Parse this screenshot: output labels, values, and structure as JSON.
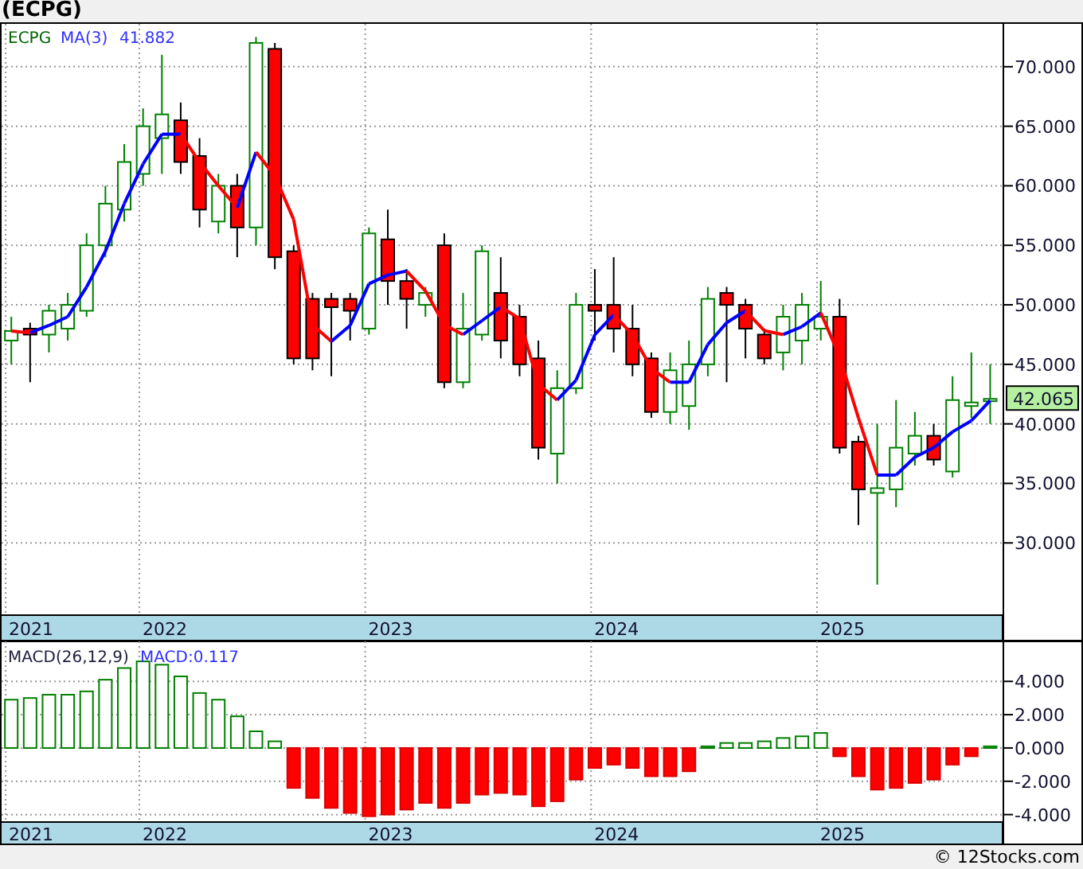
{
  "title": "(ECPG)",
  "price_chart": {
    "legend": {
      "indicator": "MA(3)",
      "indicator_value": "41.882"
    },
    "last_price": "42.065",
    "year_labels": [
      "2021",
      "2022",
      "2023",
      "2024",
      "2025"
    ],
    "chart_data": {
      "type": "candlestick",
      "title": "ECPG",
      "grid": true,
      "ylim": [
        24,
        73.6
      ],
      "ohlc": [
        [
          47,
          49,
          45,
          47.8
        ],
        [
          48,
          48.5,
          43.5,
          47.5
        ],
        [
          47.5,
          50,
          46,
          49.5
        ],
        [
          48,
          51,
          47,
          50
        ],
        [
          49.5,
          56,
          49,
          55
        ],
        [
          55,
          60,
          54,
          58.5
        ],
        [
          58,
          63.5,
          57,
          62
        ],
        [
          61,
          66.5,
          60,
          65
        ],
        [
          64,
          71,
          61,
          66
        ],
        [
          65.5,
          67,
          61,
          62
        ],
        [
          62.5,
          64,
          56.5,
          58
        ],
        [
          57,
          61,
          56,
          60
        ],
        [
          60,
          61,
          54,
          56.5
        ],
        [
          56.5,
          72.5,
          55,
          72
        ],
        [
          71.5,
          72,
          53,
          54
        ],
        [
          54.5,
          55,
          45,
          45.5
        ],
        [
          50.5,
          51,
          44.5,
          45.5
        ],
        [
          50.5,
          51,
          44,
          49.8
        ],
        [
          50.5,
          51,
          47,
          49.5
        ],
        [
          48,
          56.5,
          47.5,
          56
        ],
        [
          55.5,
          58,
          50,
          52
        ],
        [
          52,
          53,
          48,
          50.5
        ],
        [
          50,
          51.5,
          49,
          51
        ],
        [
          55,
          56,
          43,
          43.5
        ],
        [
          43.5,
          51,
          43,
          48
        ],
        [
          47.5,
          55,
          47,
          54.5
        ],
        [
          51,
          54,
          45.5,
          47
        ],
        [
          49,
          50,
          44,
          45
        ],
        [
          45.5,
          47,
          37,
          38
        ],
        [
          37.5,
          44.5,
          35,
          43
        ],
        [
          43,
          51,
          42.5,
          50
        ],
        [
          50,
          53,
          47,
          49.5
        ],
        [
          50,
          54,
          46,
          48
        ],
        [
          48,
          50,
          44,
          45
        ],
        [
          45.5,
          46,
          40.5,
          41
        ],
        [
          41,
          46,
          40,
          44.5
        ],
        [
          41.5,
          47,
          39.5,
          45
        ],
        [
          45,
          51.5,
          44,
          50.5
        ],
        [
          51,
          51.5,
          43.5,
          50
        ],
        [
          50,
          50.5,
          45.5,
          48
        ],
        [
          47.5,
          48,
          45,
          45.5
        ],
        [
          46,
          50,
          44.5,
          49
        ],
        [
          47,
          51,
          45,
          50
        ],
        [
          48,
          52,
          47,
          49
        ],
        [
          49,
          50.5,
          37.5,
          38
        ],
        [
          38.5,
          39,
          31.5,
          34.5
        ],
        [
          34.2,
          40,
          26.5,
          34.6
        ],
        [
          34.5,
          42,
          33,
          38
        ],
        [
          37.5,
          41,
          36.5,
          39
        ],
        [
          39,
          40,
          36.5,
          37
        ],
        [
          36,
          44,
          35.5,
          42
        ],
        [
          41.5,
          46,
          40.5,
          41.8
        ],
        [
          41.9,
          45,
          40,
          42.1
        ]
      ],
      "yticks": [
        {
          "value": 30,
          "label": "30.000"
        },
        {
          "value": 35,
          "label": "35.000"
        },
        {
          "value": 40,
          "label": "40.000"
        },
        {
          "value": 45,
          "label": "45.000"
        },
        {
          "value": 50,
          "label": "50.000"
        },
        {
          "value": 55,
          "label": "55.000"
        },
        {
          "value": 60,
          "label": "60.000"
        },
        {
          "value": 65,
          "label": "65.000"
        },
        {
          "value": 70,
          "label": "70.000"
        }
      ]
    }
  },
  "macd_chart": {
    "legend": {
      "name": "MACD(26,12,9)",
      "value": "MACD:0.117"
    },
    "year_labels": [
      "2021",
      "2022",
      "2023",
      "2024",
      "2025"
    ],
    "chart_data": {
      "type": "bar",
      "grid": true,
      "ylim": [
        -4.4,
        6.4
      ],
      "values": [
        2.9,
        3.0,
        3.2,
        3.2,
        3.4,
        4.1,
        4.8,
        5.2,
        5.0,
        4.3,
        3.3,
        2.9,
        1.9,
        1.0,
        0.4,
        -2.4,
        -3.0,
        -3.6,
        -3.9,
        -4.1,
        -4.0,
        -3.7,
        -3.3,
        -3.6,
        -3.3,
        -2.8,
        -2.7,
        -2.8,
        -3.5,
        -3.2,
        -1.9,
        -1.2,
        -1.0,
        -1.2,
        -1.7,
        -1.7,
        -1.4,
        0.1,
        0.3,
        0.3,
        0.4,
        0.6,
        0.7,
        0.9,
        -0.5,
        -1.7,
        -2.5,
        -2.4,
        -2.1,
        -1.9,
        -1.0,
        -0.5,
        0.1
      ],
      "yticks": [
        {
          "value": -4,
          "label": "-4.000"
        },
        {
          "value": -2,
          "label": "-2.000"
        },
        {
          "value": 0,
          "label": "0.000"
        },
        {
          "value": 2,
          "label": "2.000"
        },
        {
          "value": 4,
          "label": "4.000"
        }
      ]
    }
  },
  "credit": "© 12Stocks.com"
}
